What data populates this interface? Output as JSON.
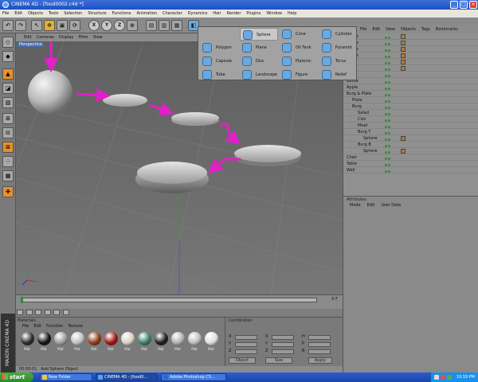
{
  "window": {
    "title": "CINEMA 4D - [food0002.c4d *]"
  },
  "menubar": [
    "File",
    "Edit",
    "Objects",
    "Tools",
    "Selection",
    "Structure",
    "Functions",
    "Animation",
    "Character",
    "Dynamics",
    "Hair",
    "Render",
    "Plugins",
    "Window",
    "Help"
  ],
  "toolbar": {
    "buttons": [
      "undo",
      "redo",
      "select-live",
      "move",
      "scale",
      "rotate",
      "x-axis",
      "y-axis",
      "z-axis",
      "coordinate-system",
      "render-view",
      "render-picture-viewer",
      "render-settings",
      "cube"
    ],
    "axis_labels": [
      "X",
      "Y",
      "Z"
    ]
  },
  "viewport": {
    "menu": [
      "Edit",
      "Cameras",
      "Display",
      "Filter",
      "View"
    ],
    "label": "Perspective"
  },
  "primitives_popup": {
    "items": [
      {
        "label": "Sphere",
        "icon": "sphere-icon",
        "highlighted": true
      },
      {
        "label": "Cone",
        "icon": "cone-icon"
      },
      {
        "label": "Cylinder",
        "icon": "cylinder-icon"
      },
      {
        "label": "Polygon",
        "icon": "polygon-icon"
      },
      {
        "label": "Plane",
        "icon": "plane-icon"
      },
      {
        "label": "Oil Tank",
        "icon": "oil-tank-icon"
      },
      {
        "label": "Pyramid",
        "icon": "pyramid-icon"
      },
      {
        "label": "Capsule",
        "icon": "capsule-icon"
      },
      {
        "label": "Disc",
        "icon": "disc-icon"
      },
      {
        "label": "Platonic",
        "icon": "platonic-icon"
      },
      {
        "label": "Torus",
        "icon": "torus-icon"
      },
      {
        "label": "Tube",
        "icon": "tube-icon"
      },
      {
        "label": "Landscape",
        "icon": "landscape-icon"
      },
      {
        "label": "Figure",
        "icon": "figure-icon"
      },
      {
        "label": "Relief",
        "icon": "relief-icon"
      }
    ]
  },
  "object_manager": {
    "menu": [
      "File",
      "Edit",
      "View",
      "Objects",
      "Tags",
      "Bookmarks"
    ],
    "rows": [
      {
        "name": "heese",
        "indent": 0
      },
      {
        "name": "heese",
        "indent": 0
      },
      {
        "name": "heese",
        "indent": 0
      },
      {
        "name": "heese",
        "indent": 0
      },
      {
        "name": "ds",
        "indent": 0
      },
      {
        "name": "er",
        "indent": 0
      },
      {
        "name": "le",
        "indent": 0
      },
      {
        "name": "Bottle",
        "indent": 0
      },
      {
        "name": "Apple",
        "indent": 0
      },
      {
        "name": "Burg & Plate",
        "indent": 0
      },
      {
        "name": "Plate",
        "indent": 1
      },
      {
        "name": "Burg",
        "indent": 1
      },
      {
        "name": "Salad",
        "indent": 2
      },
      {
        "name": "Cizz",
        "indent": 2
      },
      {
        "name": "Meat",
        "indent": 2
      },
      {
        "name": "Burg T",
        "indent": 2
      },
      {
        "name": "Sphere",
        "indent": 3
      },
      {
        "name": "Burg B",
        "indent": 2
      },
      {
        "name": "Sphere",
        "indent": 3
      },
      {
        "name": "Chair",
        "indent": 0
      },
      {
        "name": "Table",
        "indent": 0
      },
      {
        "name": "Wall",
        "indent": 0
      }
    ]
  },
  "attributes": {
    "title": "Attributes",
    "menu": [
      "Mode",
      "Edit",
      "User Data"
    ]
  },
  "timeline": {
    "start": "0",
    "end": "0 F"
  },
  "materials": {
    "title": "Materials",
    "menu": [
      "File",
      "Edit",
      "Function",
      "Texture"
    ],
    "items": [
      {
        "label": "Mat",
        "color": "#2a2a2a"
      },
      {
        "label": "Mat",
        "color": "#111111"
      },
      {
        "label": "Mat",
        "color": "#9a9a9a"
      },
      {
        "label": "Mat",
        "color": "#c0c0c0"
      },
      {
        "label": "Mat",
        "color": "#8b3a12"
      },
      {
        "label": "Mat",
        "color": "#a01010"
      },
      {
        "label": "Mat",
        "color": "#d8d0c0"
      },
      {
        "label": "Mat",
        "color": "#3a7a6a"
      },
      {
        "label": "Mat",
        "color": "#1a1a1a"
      },
      {
        "label": "Mat",
        "color": "#b0b0b0"
      },
      {
        "label": "Mat",
        "color": "#bbbbbb"
      },
      {
        "label": "Mat",
        "color": "#dddddd"
      }
    ]
  },
  "coordinates": {
    "title": "Coordinates",
    "axes": [
      "X",
      "Y",
      "Z"
    ],
    "size_axes": [
      "X",
      "Y",
      "Z"
    ],
    "rot_axes": [
      "H",
      "P",
      "B"
    ],
    "object_mode": "Object",
    "size_mode": "Size",
    "apply_label": "Apply"
  },
  "statusbar": {
    "time": "00:00:01",
    "message": "Add Sphere Object"
  },
  "taskbar": {
    "start": "start",
    "tasks": [
      {
        "label": "New Folder"
      },
      {
        "label": "CINEMA 4D - [food0..."
      },
      {
        "label": "Adobe Photoshop CS..."
      }
    ],
    "clock": "10:19 PM"
  },
  "colors": {
    "annotation": "#e020c8",
    "viewport_bg": "#6a6a6a",
    "accent": "#e0b030"
  }
}
